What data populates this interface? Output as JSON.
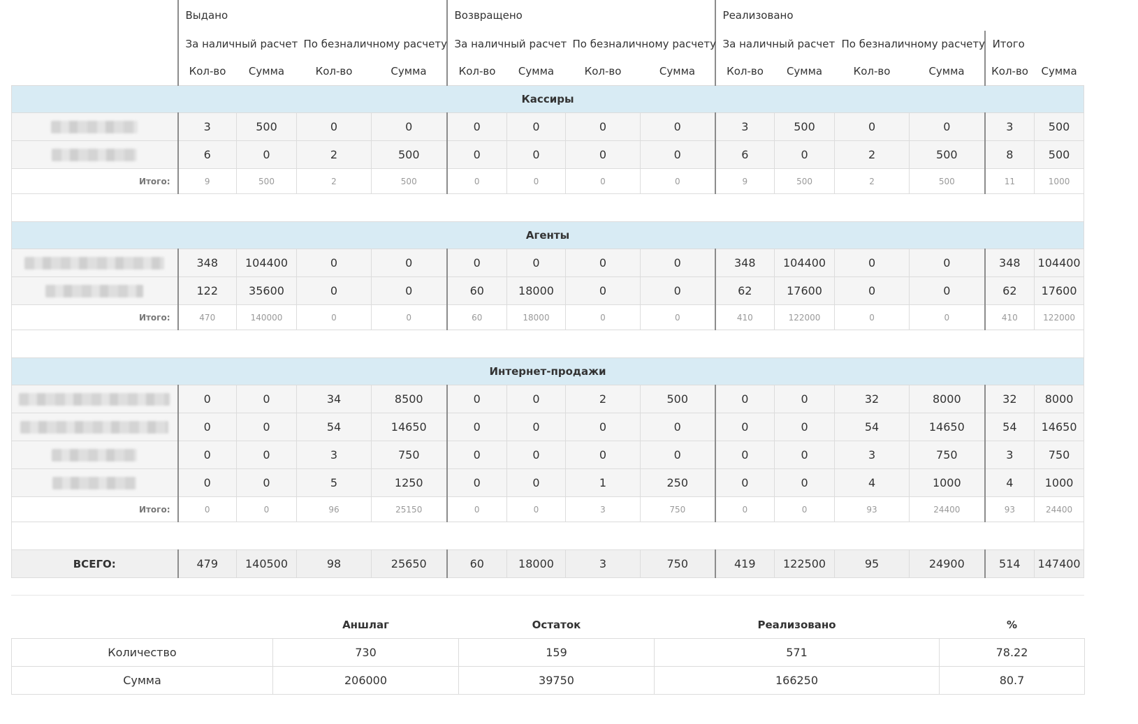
{
  "header": {
    "groups": [
      "Выдано",
      "Возвращено",
      "Реализовано"
    ],
    "cash": "За наличный расчет",
    "noncash": "По безналичному расчету",
    "total": "Итого",
    "qty": "Кол-во",
    "sum": "Сумма"
  },
  "sections": [
    {
      "title": "Кассиры",
      "rows": [
        [
          "3",
          "500",
          "0",
          "0",
          "0",
          "0",
          "0",
          "0",
          "3",
          "500",
          "0",
          "0",
          "3",
          "500"
        ],
        [
          "6",
          "0",
          "2",
          "500",
          "0",
          "0",
          "0",
          "0",
          "6",
          "0",
          "2",
          "500",
          "8",
          "500"
        ]
      ],
      "subtotal_label": "Итого:",
      "subtotal": [
        "9",
        "500",
        "2",
        "500",
        "0",
        "0",
        "0",
        "0",
        "9",
        "500",
        "2",
        "500",
        "11",
        "1000"
      ]
    },
    {
      "title": "Агенты",
      "rows": [
        [
          "348",
          "104400",
          "0",
          "0",
          "0",
          "0",
          "0",
          "0",
          "348",
          "104400",
          "0",
          "0",
          "348",
          "104400"
        ],
        [
          "122",
          "35600",
          "0",
          "0",
          "60",
          "18000",
          "0",
          "0",
          "62",
          "17600",
          "0",
          "0",
          "62",
          "17600"
        ]
      ],
      "subtotal_label": "Итого:",
      "subtotal": [
        "470",
        "140000",
        "0",
        "0",
        "60",
        "18000",
        "0",
        "0",
        "410",
        "122000",
        "0",
        "0",
        "410",
        "122000"
      ]
    },
    {
      "title": "Интернет-продажи",
      "rows": [
        [
          "0",
          "0",
          "34",
          "8500",
          "0",
          "0",
          "2",
          "500",
          "0",
          "0",
          "32",
          "8000",
          "32",
          "8000"
        ],
        [
          "0",
          "0",
          "54",
          "14650",
          "0",
          "0",
          "0",
          "0",
          "0",
          "0",
          "54",
          "14650",
          "54",
          "14650"
        ],
        [
          "0",
          "0",
          "3",
          "750",
          "0",
          "0",
          "0",
          "0",
          "0",
          "0",
          "3",
          "750",
          "3",
          "750"
        ],
        [
          "0",
          "0",
          "5",
          "1250",
          "0",
          "0",
          "1",
          "250",
          "0",
          "0",
          "4",
          "1000",
          "4",
          "1000"
        ]
      ],
      "subtotal_label": "Итого:",
      "subtotal": [
        "0",
        "0",
        "96",
        "25150",
        "0",
        "0",
        "3",
        "750",
        "0",
        "0",
        "93",
        "24400",
        "93",
        "24400"
      ]
    }
  ],
  "grand_total": {
    "label": "ВСЕГО:",
    "values": [
      "479",
      "140500",
      "98",
      "25650",
      "60",
      "18000",
      "3",
      "750",
      "419",
      "122500",
      "95",
      "24900",
      "514",
      "147400"
    ]
  },
  "summary": {
    "headers": [
      "Аншлаг",
      "Остаток",
      "Реализовано",
      "%"
    ],
    "rows": [
      {
        "label": "Количество",
        "values": [
          "730",
          "159",
          "571",
          "78.22"
        ]
      },
      {
        "label": "Сумма",
        "values": [
          "206000",
          "39750",
          "166250",
          "80.7"
        ]
      }
    ]
  }
}
